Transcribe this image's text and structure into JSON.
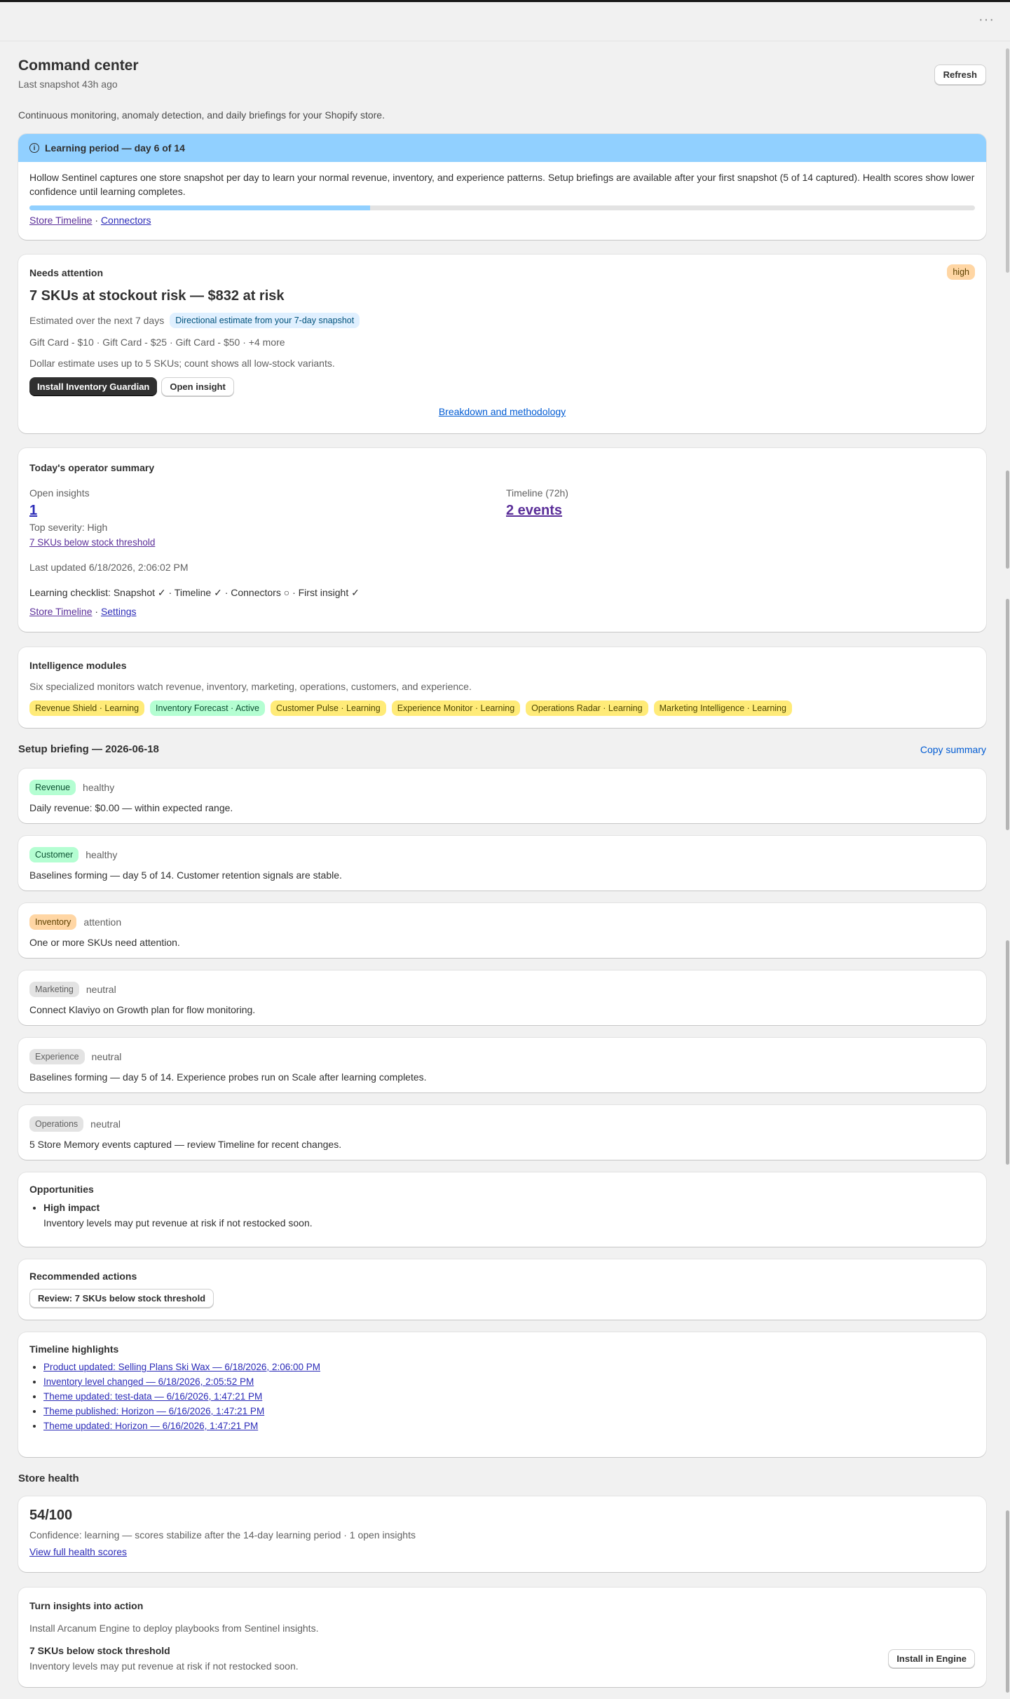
{
  "topbar": {
    "menu_glyph": "···"
  },
  "header": {
    "title": "Command center",
    "snapshot": "Last snapshot 43h ago",
    "refresh_label": "Refresh",
    "description": "Continuous monitoring, anomaly detection, and daily briefings for your Shopify store."
  },
  "learning": {
    "title": "Learning period — day 6 of 14",
    "body": "Hollow Sentinel captures one store snapshot per day to learn your normal revenue, inventory, and experience patterns. Setup briefings are available after your first snapshot (5 of 14 captured). Health scores show lower confidence until learning completes.",
    "progress_fraction": 0.36,
    "link_timeline": "Store Timeline",
    "separator": "·",
    "link_connectors": "Connectors"
  },
  "attention": {
    "title": "Needs attention",
    "severity": "high",
    "headline": "7 SKUs at stockout risk — $832 at risk",
    "estimate_text": "Estimated over the next 7 days",
    "estimate_badge": "Directional estimate from your 7-day snapshot",
    "items": "Gift Card - $10 · Gift Card - $25 · Gift Card - $50 · +4 more",
    "note": "Dollar estimate uses up to 5 SKUs; count shows all low-stock variants.",
    "primary_button": "Install Inventory Guardian",
    "secondary_button": "Open insight",
    "breakdown_link": "Breakdown and methodology"
  },
  "operator": {
    "title": "Today's operator summary",
    "open_label": "Open insights",
    "open_value": "1",
    "timeline_label": "Timeline (72h)",
    "timeline_value": "2 events",
    "top_severity": "Top severity: High",
    "top_link": "7 SKUs below stock threshold",
    "last_updated": "Last updated 6/18/2026, 2:06:02 PM",
    "checklist": "Learning checklist: Snapshot ✓ · Timeline ✓ · Connectors ○ · First insight ✓",
    "link_timeline": "Store Timeline",
    "separator": "·",
    "link_settings": "Settings"
  },
  "modules": {
    "title": "Intelligence modules",
    "description": "Six specialized monitors watch revenue, inventory, marketing, operations, customers, and experience.",
    "items": [
      {
        "label": "Revenue Shield · Learning",
        "tone": "yellow"
      },
      {
        "label": "Inventory Forecast · Active",
        "tone": "green"
      },
      {
        "label": "Customer Pulse · Learning",
        "tone": "yellow"
      },
      {
        "label": "Experience Monitor · Learning",
        "tone": "yellow"
      },
      {
        "label": "Operations Radar · Learning",
        "tone": "yellow"
      },
      {
        "label": "Marketing Intelligence · Learning",
        "tone": "yellow"
      }
    ]
  },
  "briefing": {
    "title": "Setup briefing — 2026-06-18",
    "copy_label": "Copy summary",
    "rows": [
      {
        "tag": "Revenue",
        "tone": "green",
        "status": "healthy",
        "text": "Daily revenue: $0.00 — within expected range."
      },
      {
        "tag": "Customer",
        "tone": "green",
        "status": "healthy",
        "text": "Baselines forming — day 5 of 14. Customer retention signals are stable."
      },
      {
        "tag": "Inventory",
        "tone": "orange",
        "status": "attention",
        "text": "One or more SKUs need attention."
      },
      {
        "tag": "Marketing",
        "tone": "gray",
        "status": "neutral",
        "text": "Connect Klaviyo on Growth plan for flow monitoring."
      },
      {
        "tag": "Experience",
        "tone": "gray",
        "status": "neutral",
        "text": "Baselines forming — day 5 of 14. Experience probes run on Scale after learning completes."
      },
      {
        "tag": "Operations",
        "tone": "gray",
        "status": "neutral",
        "text": "5 Store Memory events captured — review Timeline for recent changes."
      }
    ]
  },
  "opportunities": {
    "title": "Opportunities",
    "impact": "High impact",
    "text": "Inventory levels may put revenue at risk if not restocked soon."
  },
  "recommended": {
    "title": "Recommended actions",
    "button": "Review: 7 SKUs below stock threshold"
  },
  "timeline": {
    "title": "Timeline highlights",
    "items": [
      "Product updated: Selling Plans Ski Wax — 6/18/2026, 2:06:00 PM",
      "Inventory level changed — 6/18/2026, 2:05:52 PM",
      "Theme updated: test-data — 6/16/2026, 1:47:21 PM",
      "Theme published: Horizon — 6/16/2026, 1:47:21 PM",
      "Theme updated: Horizon — 6/16/2026, 1:47:21 PM"
    ]
  },
  "health": {
    "section_title": "Store health",
    "score": "54/100",
    "confidence": "Confidence: learning — scores stabilize after the 14-day learning period · 1 open insights",
    "link": "View full health scores"
  },
  "action": {
    "title": "Turn insights into action",
    "description": "Install Arcanum Engine to deploy playbooks from Sentinel insights.",
    "item_title": "7 SKUs below stock threshold",
    "item_text": "Inventory levels may put revenue at risk if not restocked soon.",
    "button": "Install in Engine"
  },
  "colors": {
    "accent_blue": "#91d0ff",
    "link_blue": "#2c2cb8",
    "copy_link": "#005bd3",
    "high_badge": "#ffd6a4",
    "learning_badge": "#ffeb78",
    "active_badge": "#b4fed2"
  }
}
